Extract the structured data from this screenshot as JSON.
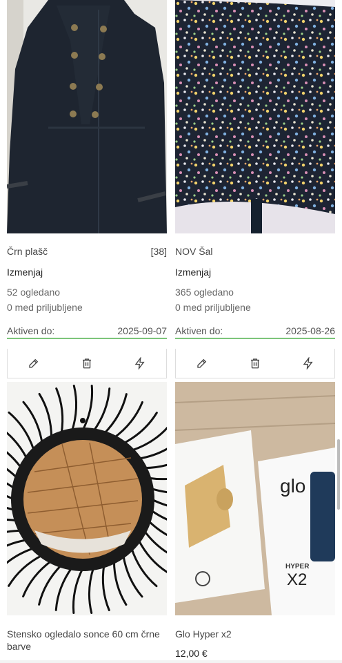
{
  "listings": [
    {
      "title": "Črn plašč",
      "size": "[38]",
      "edit_label": "Izmenjaj",
      "views": "52 ogledano",
      "favorites": "0 med priljubljene",
      "active_label": "Aktiven do:",
      "active_date": "2025-09-07"
    },
    {
      "title": "NOV Šal",
      "edit_label": "Izmenjaj",
      "views": "365 ogledano",
      "favorites": "0 med priljubljene",
      "active_label": "Aktiven do:",
      "active_date": "2025-08-26"
    },
    {
      "title": "Stensko ogledalo sonce 60 cm črne barve"
    },
    {
      "title": "Glo Hyper x2",
      "price": "12,00 €",
      "box_brand": "glo",
      "box_model": "HYPER",
      "box_model_sub": "X2"
    }
  ],
  "icons": {
    "edit": "pencil-icon",
    "delete": "trash-icon",
    "boost": "lightning-icon"
  }
}
